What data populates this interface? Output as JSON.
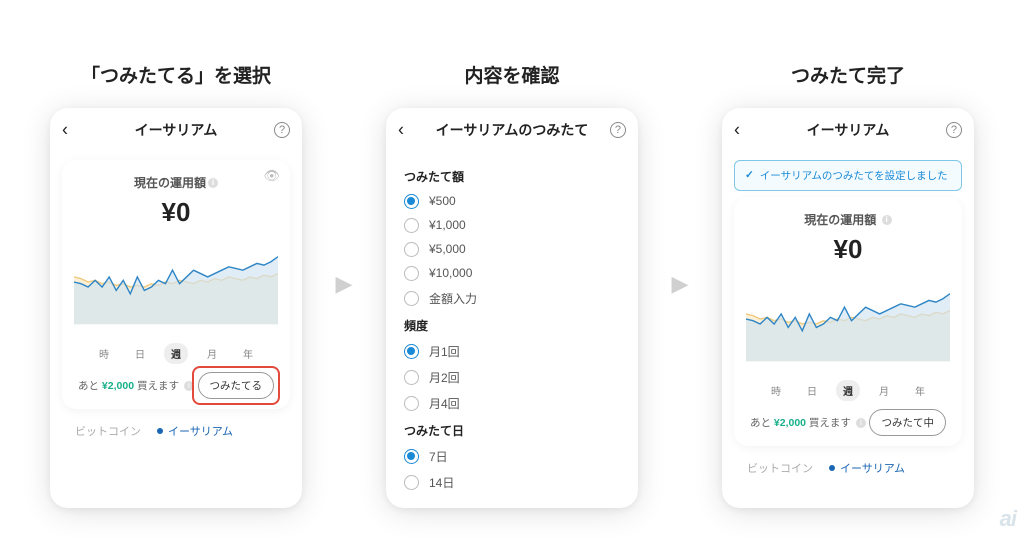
{
  "step_titles": {
    "select": "「つみたてる」を選択",
    "confirm": "内容を確認",
    "done": "つみたて完了"
  },
  "screen1": {
    "header_title": "イーサリアム",
    "op_label": "現在の運用額",
    "amount": "¥0",
    "time_labels": {
      "hour": "時",
      "day": "日",
      "week": "週",
      "month": "月",
      "year": "年"
    },
    "time_active": "週",
    "balance_prefix": "あと ",
    "balance_amount": "¥2,000",
    "balance_suffix": " 買えます",
    "accumulate_btn": "つみたてる",
    "tabs": {
      "btc": "ビットコイン",
      "eth": "イーサリアム"
    }
  },
  "screen2": {
    "header_title": "イーサリアムのつみたて",
    "group_amount": "つみたて額",
    "amount_options": [
      "¥500",
      "¥1,000",
      "¥5,000",
      "¥10,000",
      "金額入力"
    ],
    "amount_selected": "¥500",
    "group_freq": "頻度",
    "freq_options": [
      "月1回",
      "月2回",
      "月4回"
    ],
    "freq_selected": "月1回",
    "group_day": "つみたて日",
    "day_options": [
      "7日",
      "14日"
    ],
    "day_selected": "7日"
  },
  "screen3": {
    "header_title": "イーサリアム",
    "toast": "イーサリアムのつみたてを設定しました",
    "op_label": "現在の運用額",
    "amount": "¥0",
    "balance_prefix": "あと ",
    "balance_amount": "¥2,000",
    "balance_suffix": " 買えます",
    "accumulate_btn": "つみたて中",
    "tabs": {
      "btc": "ビットコイン",
      "eth": "イーサリアム"
    }
  },
  "chart_data": {
    "type": "line",
    "title": "",
    "xlabel": "",
    "ylabel": "",
    "x": [
      0,
      1,
      2,
      3,
      4,
      5,
      6,
      7,
      8,
      9,
      10,
      11,
      12,
      13,
      14,
      15,
      16,
      17,
      18,
      19,
      20,
      21,
      22,
      23,
      24,
      25,
      26,
      27,
      28,
      29
    ],
    "series": [
      {
        "name": "secondary-yellow",
        "values": [
          58,
          57,
          55,
          56,
          54,
          55,
          53,
          54,
          52,
          53,
          52,
          54,
          53,
          55,
          54,
          56,
          55,
          54,
          56,
          55,
          57,
          56,
          58,
          57,
          56,
          58,
          57,
          59,
          58,
          60
        ],
        "stroke": "#efc97c",
        "fill": "#fbe9c3"
      },
      {
        "name": "primary-blue",
        "values": [
          55,
          54,
          52,
          56,
          52,
          58,
          50,
          56,
          48,
          58,
          50,
          52,
          56,
          54,
          62,
          54,
          58,
          62,
          60,
          58,
          60,
          62,
          64,
          63,
          62,
          64,
          66,
          65,
          67,
          70
        ],
        "stroke": "#2f86c6",
        "fill": "#cfe4f3"
      }
    ],
    "ylim": [
      30,
      80
    ]
  },
  "watermark": "ai"
}
